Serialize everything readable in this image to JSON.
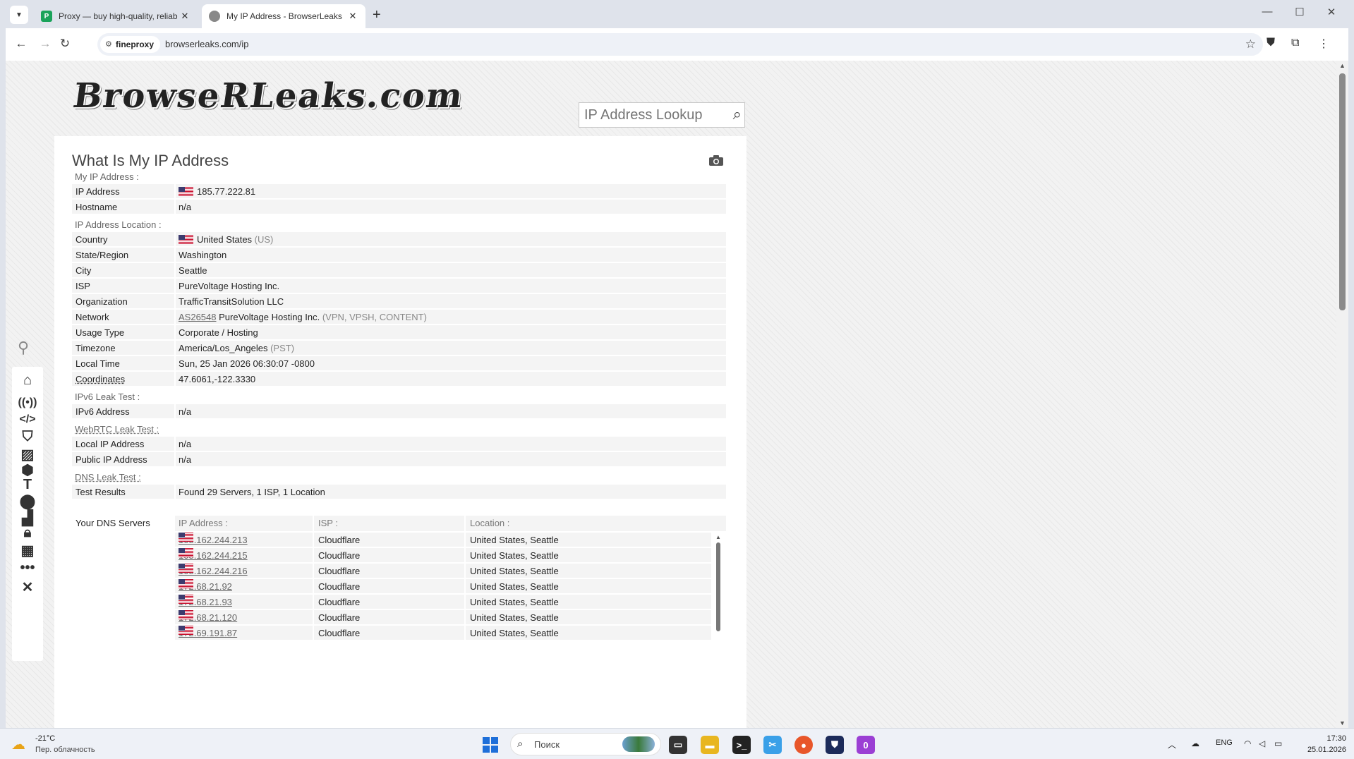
{
  "browser": {
    "tabs": [
      {
        "title": "Proxy — buy high-quality, reliab",
        "favicon": "P"
      },
      {
        "title": "My IP Address - BrowserLeaks"
      }
    ],
    "chip_label": "fineproxy",
    "url": "browserleaks.com/ip"
  },
  "site": {
    "logo_text": "BrowseRLeaks.com",
    "lookup_placeholder": "IP Address Lookup"
  },
  "page": {
    "title": "What Is My IP Address",
    "sections": {
      "my_ip": "My IP Address :",
      "location": "IP Address Location :",
      "ipv6": "IPv6 Leak Test :",
      "webrtc": "WebRTC Leak Test :",
      "dns": "DNS Leak Test :"
    },
    "ip_address": {
      "label": "IP Address",
      "value": "185.77.222.81"
    },
    "hostname": {
      "label": "Hostname",
      "value": "n/a"
    },
    "country": {
      "label": "Country",
      "value": "United States",
      "code": "(US)"
    },
    "state": {
      "label": "State/Region",
      "value": "Washington"
    },
    "city": {
      "label": "City",
      "value": "Seattle"
    },
    "isp": {
      "label": "ISP",
      "value": "PureVoltage Hosting Inc."
    },
    "organization": {
      "label": "Organization",
      "value": "TrafficTransitSolution LLC"
    },
    "network": {
      "label": "Network",
      "asn": "AS26548",
      "name": "PureVoltage Hosting Inc.",
      "tags": "(VPN, VPSH, CONTENT)"
    },
    "usage_type": {
      "label": "Usage Type",
      "value": "Corporate / Hosting"
    },
    "timezone": {
      "label": "Timezone",
      "value": "America/Los_Angeles",
      "abbr": "(PST)"
    },
    "local_time": {
      "label": "Local Time",
      "value": "Sun, 25 Jan 2026 06:30:07 -0800"
    },
    "coordinates": {
      "label": "Coordinates",
      "value": "47.6061,-122.3330"
    },
    "ipv6_address": {
      "label": "IPv6 Address",
      "value": "n/a"
    },
    "local_ip": {
      "label": "Local IP Address",
      "value": "n/a"
    },
    "public_ip": {
      "label": "Public IP Address",
      "value": "n/a"
    },
    "dns_results": {
      "label": "Test Results",
      "value": "Found 29 Servers, 1 ISP, 1 Location"
    },
    "dns_servers": {
      "label": "Your DNS Servers",
      "headers": [
        "IP Address :",
        "ISP :",
        "Location :"
      ],
      "rows": [
        {
          "ip": "108.162.244.213",
          "isp": "Cloudflare",
          "location": "United States, Seattle"
        },
        {
          "ip": "108.162.244.215",
          "isp": "Cloudflare",
          "location": "United States, Seattle"
        },
        {
          "ip": "108.162.244.216",
          "isp": "Cloudflare",
          "location": "United States, Seattle"
        },
        {
          "ip": "172.68.21.92",
          "isp": "Cloudflare",
          "location": "United States, Seattle"
        },
        {
          "ip": "172.68.21.93",
          "isp": "Cloudflare",
          "location": "United States, Seattle"
        },
        {
          "ip": "172.68.21.120",
          "isp": "Cloudflare",
          "location": "United States, Seattle"
        },
        {
          "ip": "172.69.191.87",
          "isp": "Cloudflare",
          "location": "United States, Seattle"
        }
      ]
    }
  },
  "sidebar_icons": [
    "pin-icon",
    "home-icon",
    "broadcast-icon",
    "code-icon",
    "shield-icon",
    "image-icon",
    "cube-icon",
    "text-cursor-icon",
    "map-pin-icon",
    "chart-icon",
    "lock-icon",
    "bricks-icon",
    "more-icon",
    "tools-icon"
  ],
  "taskbar": {
    "temperature": "-21°C",
    "weather_desc": "Пер. облачность",
    "search_placeholder": "Поиск",
    "lang": "ENG",
    "time": "17:30",
    "date": "25.01.2026",
    "badge_label": "0"
  },
  "colors": {
    "accent_blue": "#1e6fd9",
    "row_bg": "#f4f4f4"
  }
}
